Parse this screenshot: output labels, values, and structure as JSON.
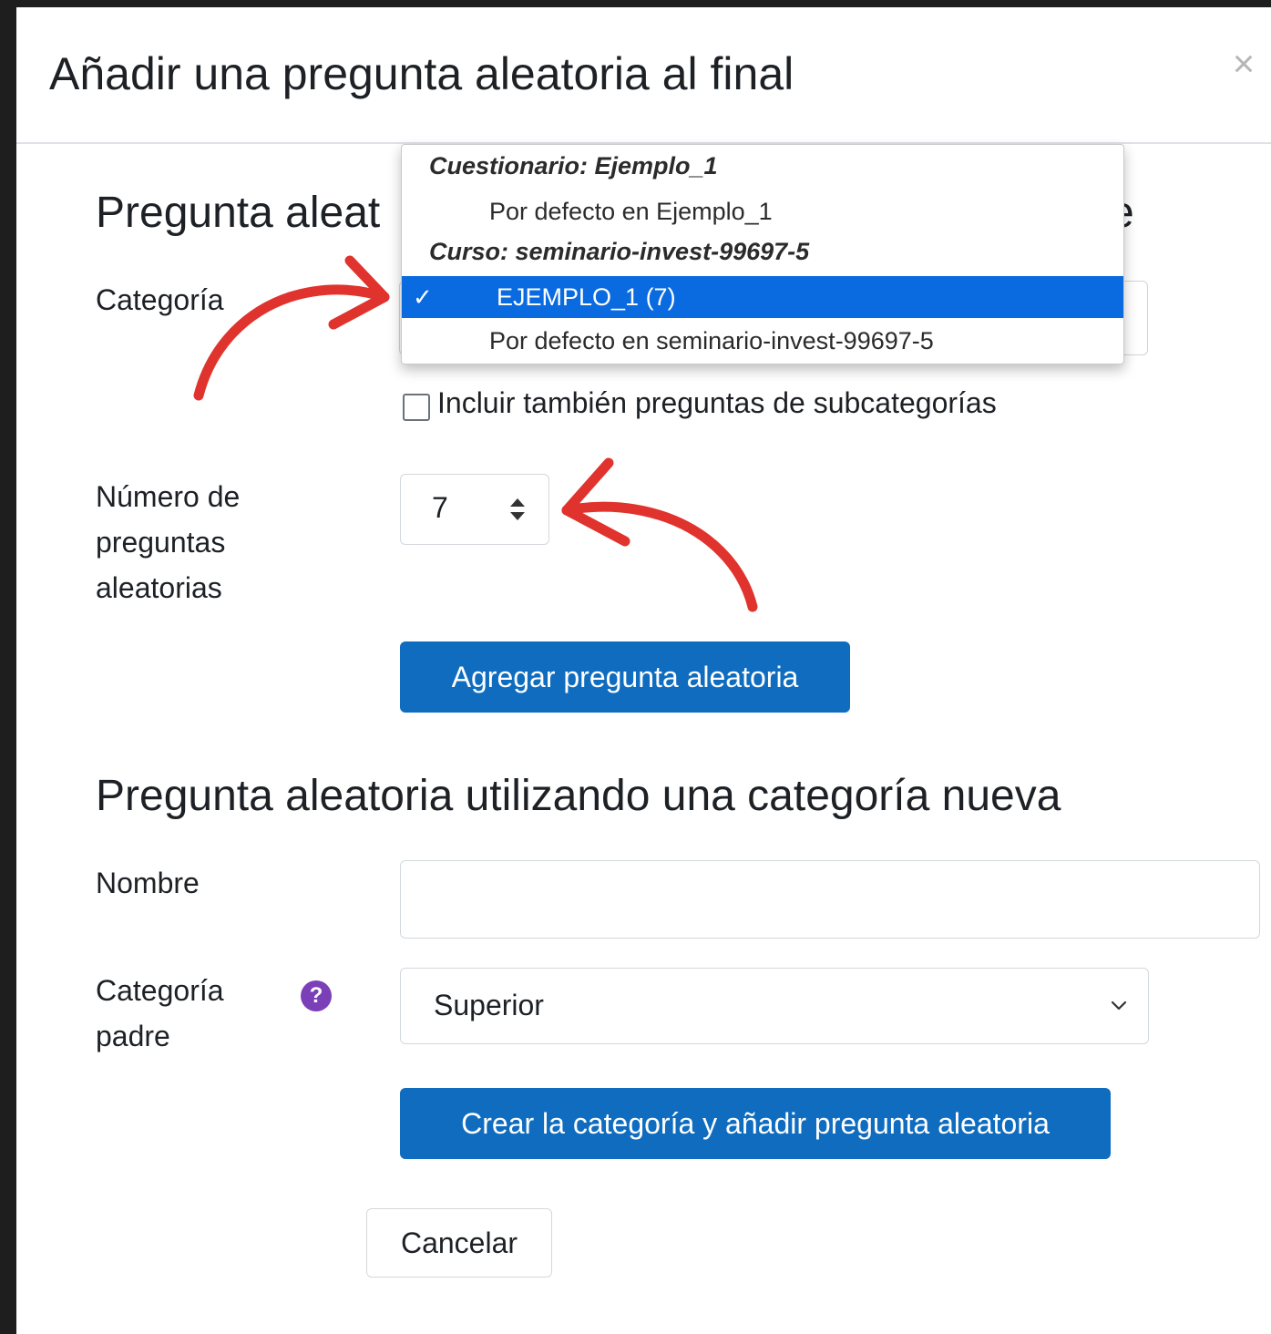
{
  "modal": {
    "title": "Añadir una pregunta aleatoria al final",
    "close_symbol": "×"
  },
  "existing_category": {
    "heading_visible": "Pregunta aleat",
    "heading_trailing": "e",
    "category_label": "Categoría",
    "dropdown": {
      "groups": [
        {
          "label": "Cuestionario: Ejemplo_1",
          "options": [
            {
              "label": "Por defecto en Ejemplo_1",
              "selected": false
            }
          ]
        },
        {
          "label": "Curso: seminario-invest-99697-5",
          "options": [
            {
              "label": "EJEMPLO_1 (7)",
              "selected": true
            },
            {
              "label": "Por defecto en seminario-invest-99697-5",
              "selected": false
            }
          ]
        }
      ],
      "check_symbol": "✓"
    },
    "include_subcategories_label": "Incluir también preguntas de subcategorías",
    "include_subcategories_checked": false,
    "number_label_lines": [
      "Número de",
      "preguntas",
      "aleatorias"
    ],
    "number_value": "7",
    "add_button": "Agregar pregunta aleatoria"
  },
  "new_category": {
    "heading": "Pregunta aleatoria utilizando una categoría nueva",
    "name_label": "Nombre",
    "name_value": "",
    "parent_label_lines": [
      "Categoría",
      "padre"
    ],
    "help_symbol": "?",
    "parent_value": "Superior",
    "create_button": "Crear la categoría y añadir pregunta aleatoria"
  },
  "cancel_button": "Cancelar",
  "colors": {
    "primary": "#0f6cbf",
    "dropdown_highlight": "#0a6ae0",
    "annotation_arrow": "#e0332d",
    "help_icon": "#7b3fb8"
  }
}
